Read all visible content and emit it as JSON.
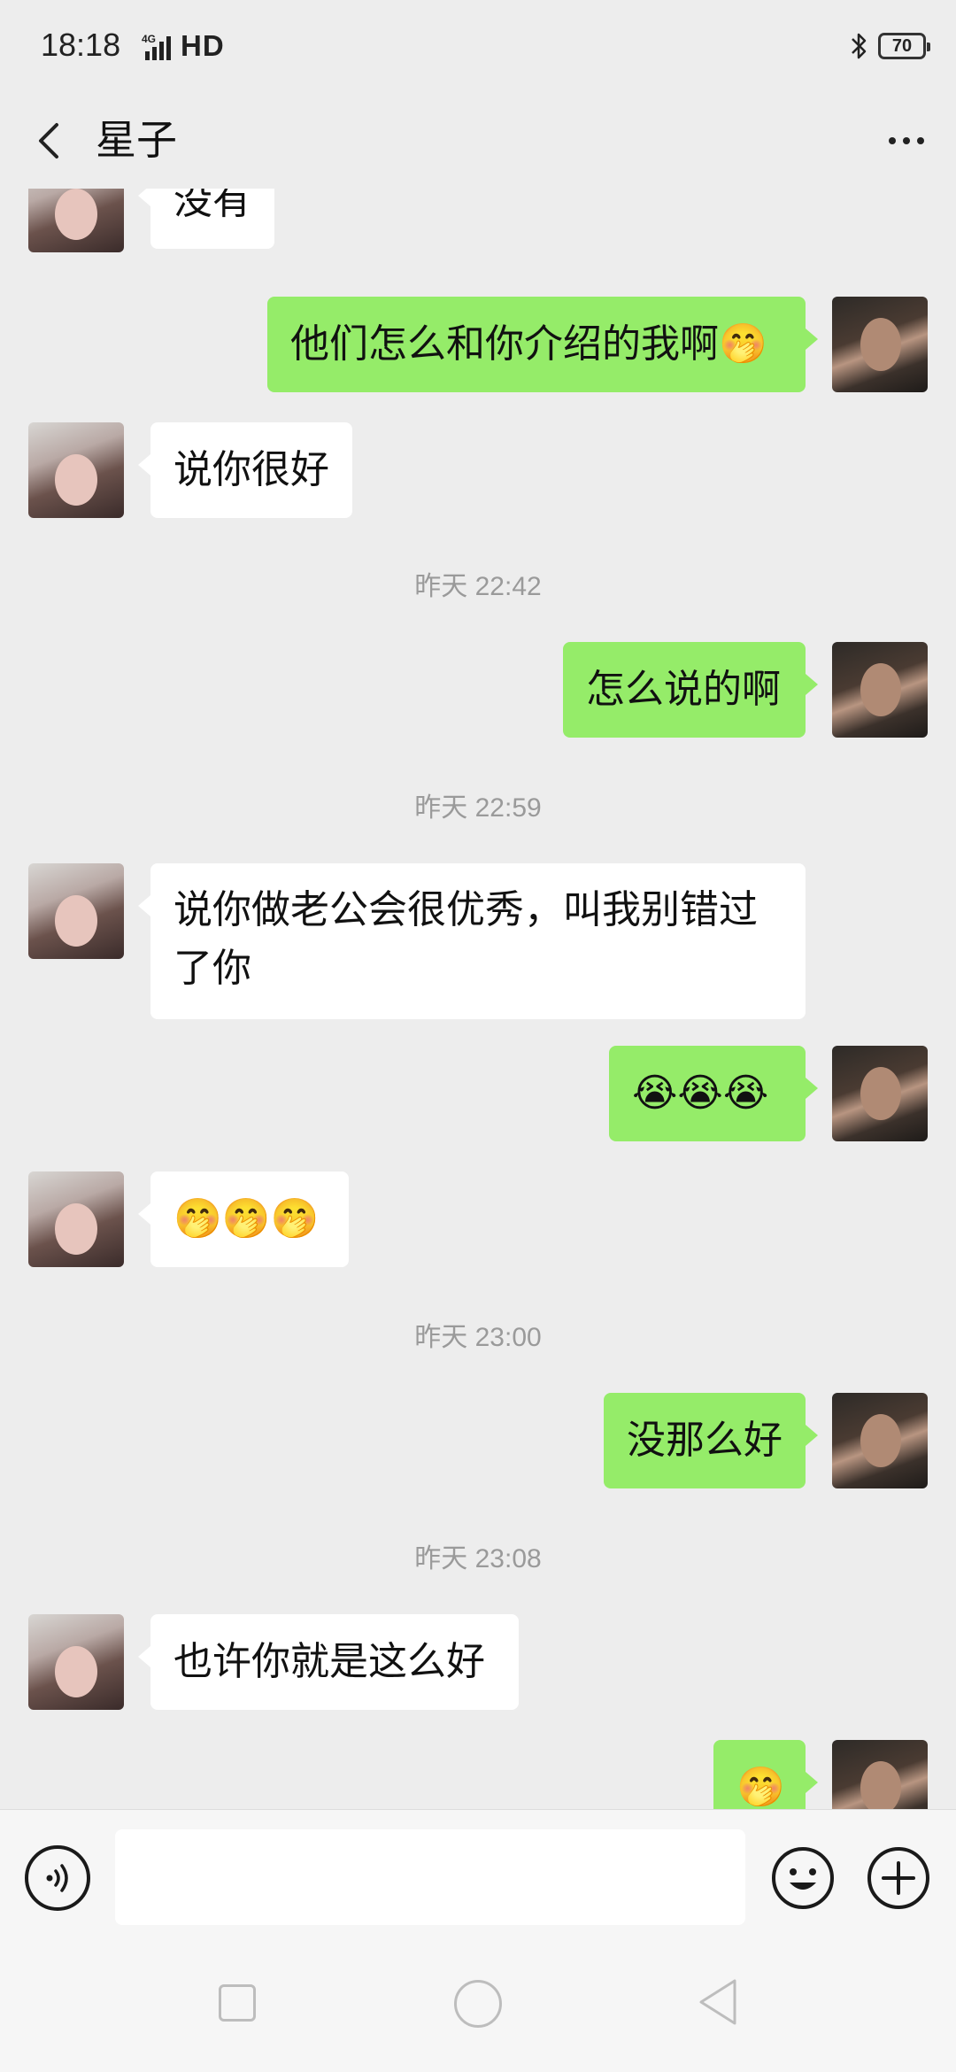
{
  "status_bar": {
    "time": "18:18",
    "network": "4G",
    "hd": "HD",
    "bluetooth_icon": "bluetooth-icon",
    "battery": "70"
  },
  "header": {
    "title": "星子",
    "back_icon": "chevron-left-icon",
    "more_icon": "more-dots-icon"
  },
  "messages": [
    {
      "from": "contact",
      "text": "没有"
    },
    {
      "from": "me",
      "text": "他们怎么和你介绍的我啊🤭"
    },
    {
      "from": "contact",
      "text": "说你很好"
    },
    {
      "timestamp": "昨天 22:42"
    },
    {
      "from": "me",
      "text": "怎么说的啊"
    },
    {
      "timestamp": "昨天 22:59"
    },
    {
      "from": "contact",
      "text_line1": "说你做老公会很优秀，叫我别错过",
      "text_line2": "了你"
    },
    {
      "from": "me",
      "text": "😭😭😭"
    },
    {
      "from": "contact",
      "text": "🤭🤭🤭"
    },
    {
      "timestamp": "昨天 23:00"
    },
    {
      "from": "me",
      "text": "没那么好"
    },
    {
      "timestamp": "昨天 23:08"
    },
    {
      "from": "contact",
      "text": "也许你就是这么好"
    },
    {
      "from": "me",
      "text": "🤭"
    }
  ],
  "input_bar": {
    "voice_icon": "voice-icon",
    "placeholder": "",
    "emoji_icon": "emoji-icon",
    "plus_icon": "plus-icon"
  },
  "system_nav": {
    "recent_icon": "square-icon",
    "home_icon": "circle-icon",
    "back_icon": "triangle-back-icon"
  },
  "colors": {
    "background": "#ededed",
    "outgoing_bubble": "#95ec69",
    "incoming_bubble": "#ffffff",
    "timestamp_text": "#9a9a9a"
  }
}
